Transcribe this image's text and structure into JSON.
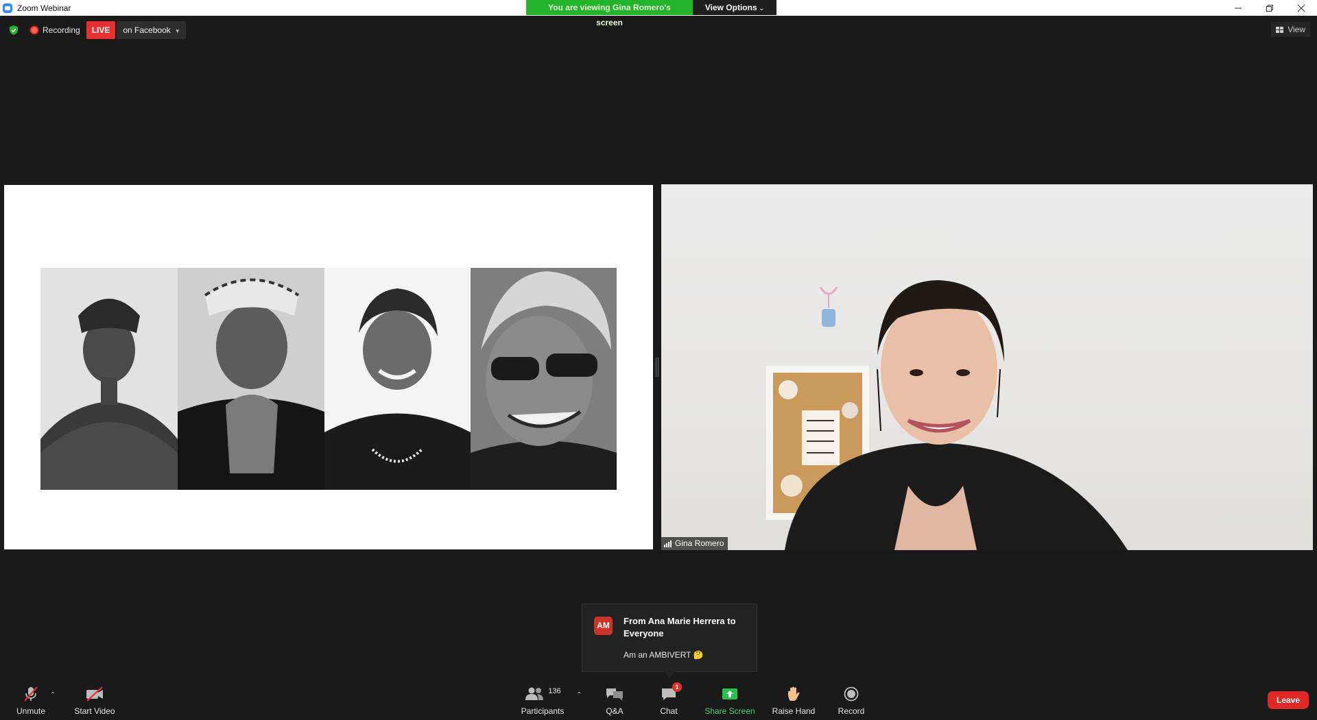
{
  "window": {
    "title": "Zoom Webinar",
    "controls": [
      "minimize",
      "restore",
      "close"
    ]
  },
  "banner": {
    "viewing_text": "You are viewing Gina Romero's screen",
    "view_options_label": "View Options"
  },
  "status": {
    "recording_label": "Recording",
    "live_label": "LIVE",
    "stream_target": "on Facebook",
    "view_label": "View"
  },
  "video": {
    "participant_name": "Gina Romero"
  },
  "chat_popup": {
    "avatar_initials": "AM",
    "from_text": "From Ana Marie Herrera to Everyone",
    "message": "Am an AMBIVERT 🤔"
  },
  "toolbar": {
    "unmute_label": "Unmute",
    "start_video_label": "Start Video",
    "participants_label": "Participants",
    "participants_count": "136",
    "qa_label": "Q&A",
    "chat_label": "Chat",
    "chat_badge": "1",
    "share_screen_label": "Share Screen",
    "raise_hand_label": "Raise Hand",
    "record_label": "Record",
    "leave_label": "Leave"
  },
  "colors": {
    "background": "#1a1a1a",
    "banner_green": "#23b32a",
    "live_red": "#e5302f",
    "leave_red": "#e02828",
    "share_green": "#3fd66b"
  }
}
